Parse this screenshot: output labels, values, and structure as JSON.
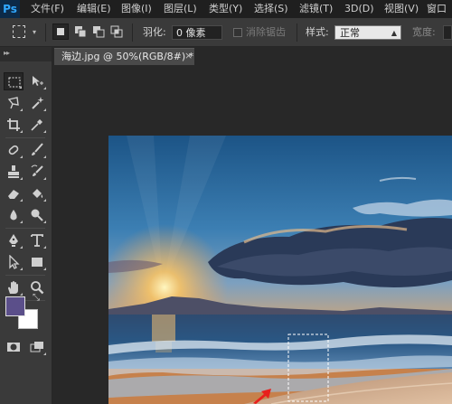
{
  "app": {
    "logo": "Ps"
  },
  "menu": [
    "文件(F)",
    "编辑(E)",
    "图像(I)",
    "图层(L)",
    "类型(Y)",
    "选择(S)",
    "滤镜(T)",
    "3D(D)",
    "视图(V)",
    "窗口"
  ],
  "options": {
    "feather_label": "羽化:",
    "feather_value": "0 像素",
    "antialias_label": "消除锯齿",
    "style_label": "样式:",
    "style_value": "正常",
    "width_label": "宽度:"
  },
  "document": {
    "tab_title": "海边.jpg @ 50%(RGB/8#) *",
    "close_glyph": "×"
  },
  "colors": {
    "foreground": "#5b4f8a",
    "background": "#ffffff",
    "accent_logo": "#31a8ff",
    "annotation_arrow": "#e8201c"
  },
  "tools": [
    "rectangular-marquee-icon",
    "move-icon",
    "lasso-icon",
    "magic-wand-icon",
    "crop-icon",
    "eyedropper-icon",
    "spot-healing-brush-icon",
    "brush-icon",
    "clone-stamp-icon",
    "history-brush-icon",
    "eraser-icon",
    "paint-bucket-icon",
    "blur-icon",
    "dodge-icon",
    "pen-icon",
    "type-icon",
    "path-selection-icon",
    "rectangle-shape-icon",
    "hand-icon",
    "zoom-icon",
    "quick-mask-icon",
    "screen-mode-icon"
  ]
}
